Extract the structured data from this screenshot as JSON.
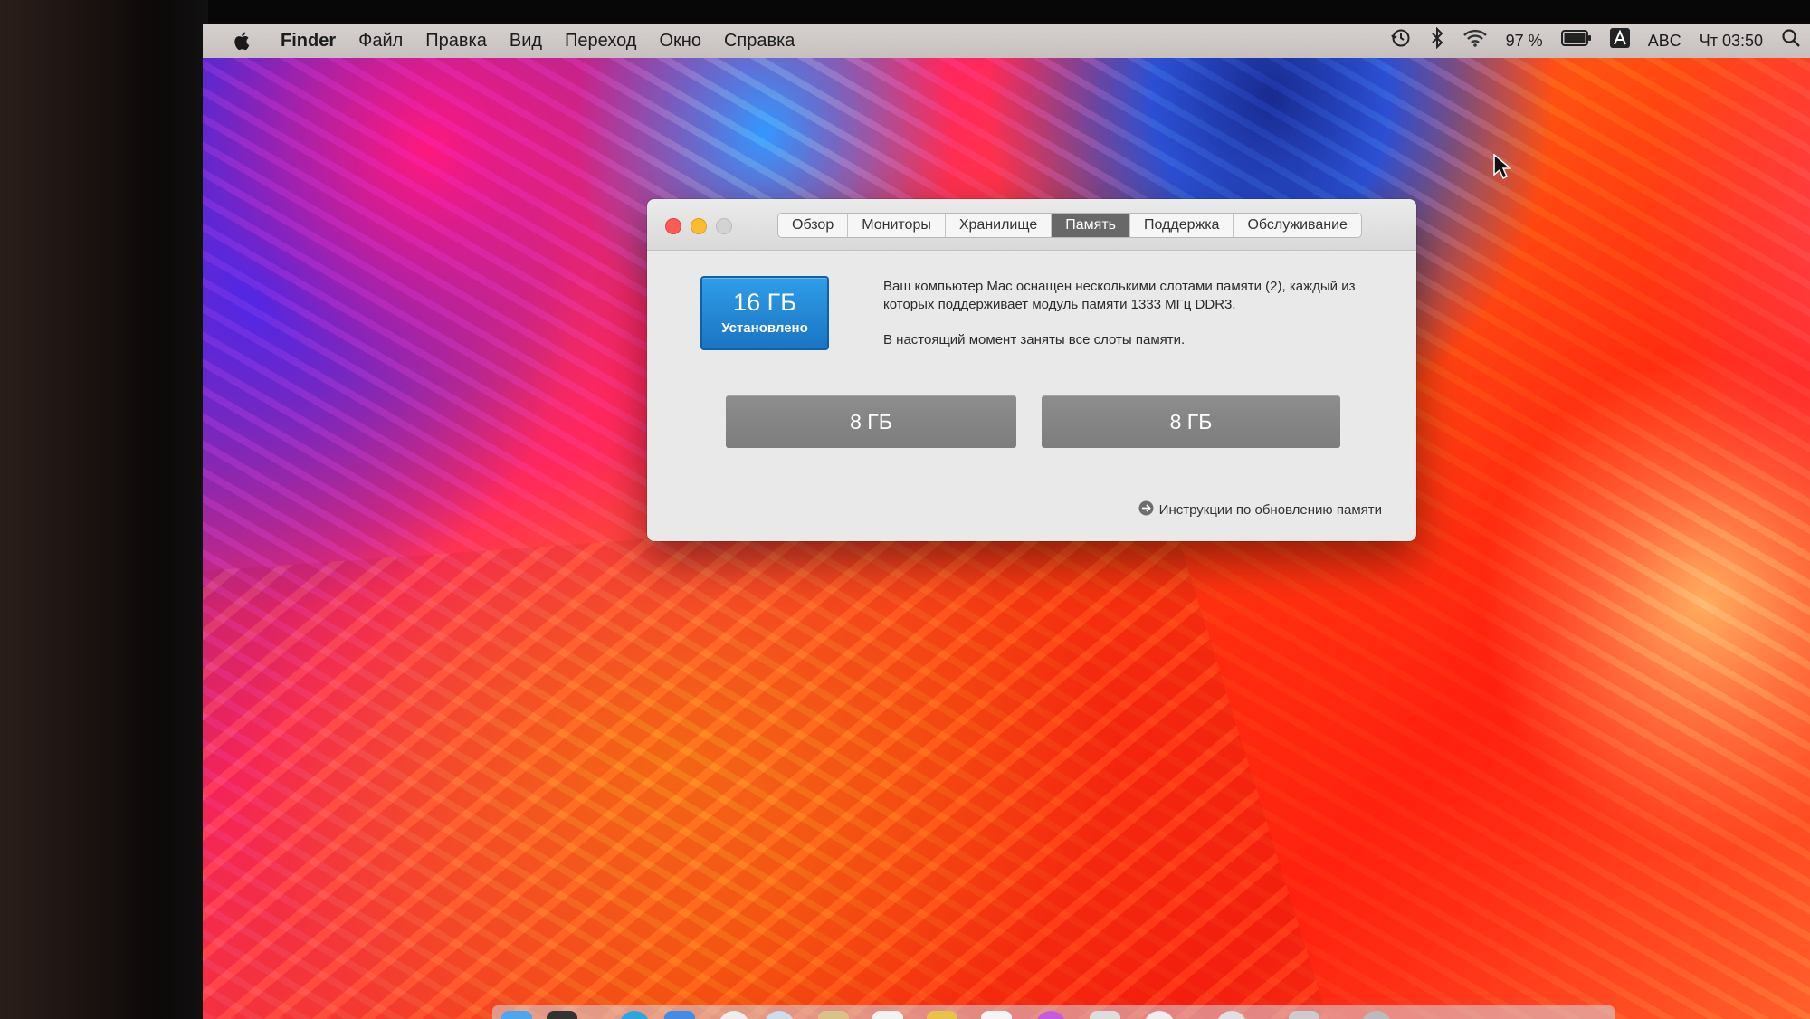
{
  "menubar": {
    "app_name": "Finder",
    "menu_items": [
      "Файл",
      "Правка",
      "Вид",
      "Переход",
      "Окно",
      "Справка"
    ],
    "battery_percent": "97 %",
    "input_source": "ABC",
    "clock": "Чт 03:50"
  },
  "window": {
    "tabs": [
      {
        "label": "Обзор",
        "active": false
      },
      {
        "label": "Мониторы",
        "active": false
      },
      {
        "label": "Хранилище",
        "active": false
      },
      {
        "label": "Память",
        "active": true
      },
      {
        "label": "Поддержка",
        "active": false
      },
      {
        "label": "Обслуживание",
        "active": false
      }
    ],
    "memory": {
      "total": "16 ГБ",
      "status": "Установлено",
      "description_1": "Ваш компьютер Mac оснащен несколькими слотами памяти (2), каждый из которых поддерживает модуль памяти 1333 МГц DDR3.",
      "description_2": "В настоящий момент заняты все слоты памяти.",
      "slots": [
        "8 ГБ",
        "8 ГБ"
      ]
    },
    "upgrade_link": "Инструкции по обновлению памяти"
  },
  "colors": {
    "active_tab": "#686868",
    "badge_blue": "#1b75c4",
    "close": "#fc5c57",
    "minimize": "#fdbc2f"
  }
}
